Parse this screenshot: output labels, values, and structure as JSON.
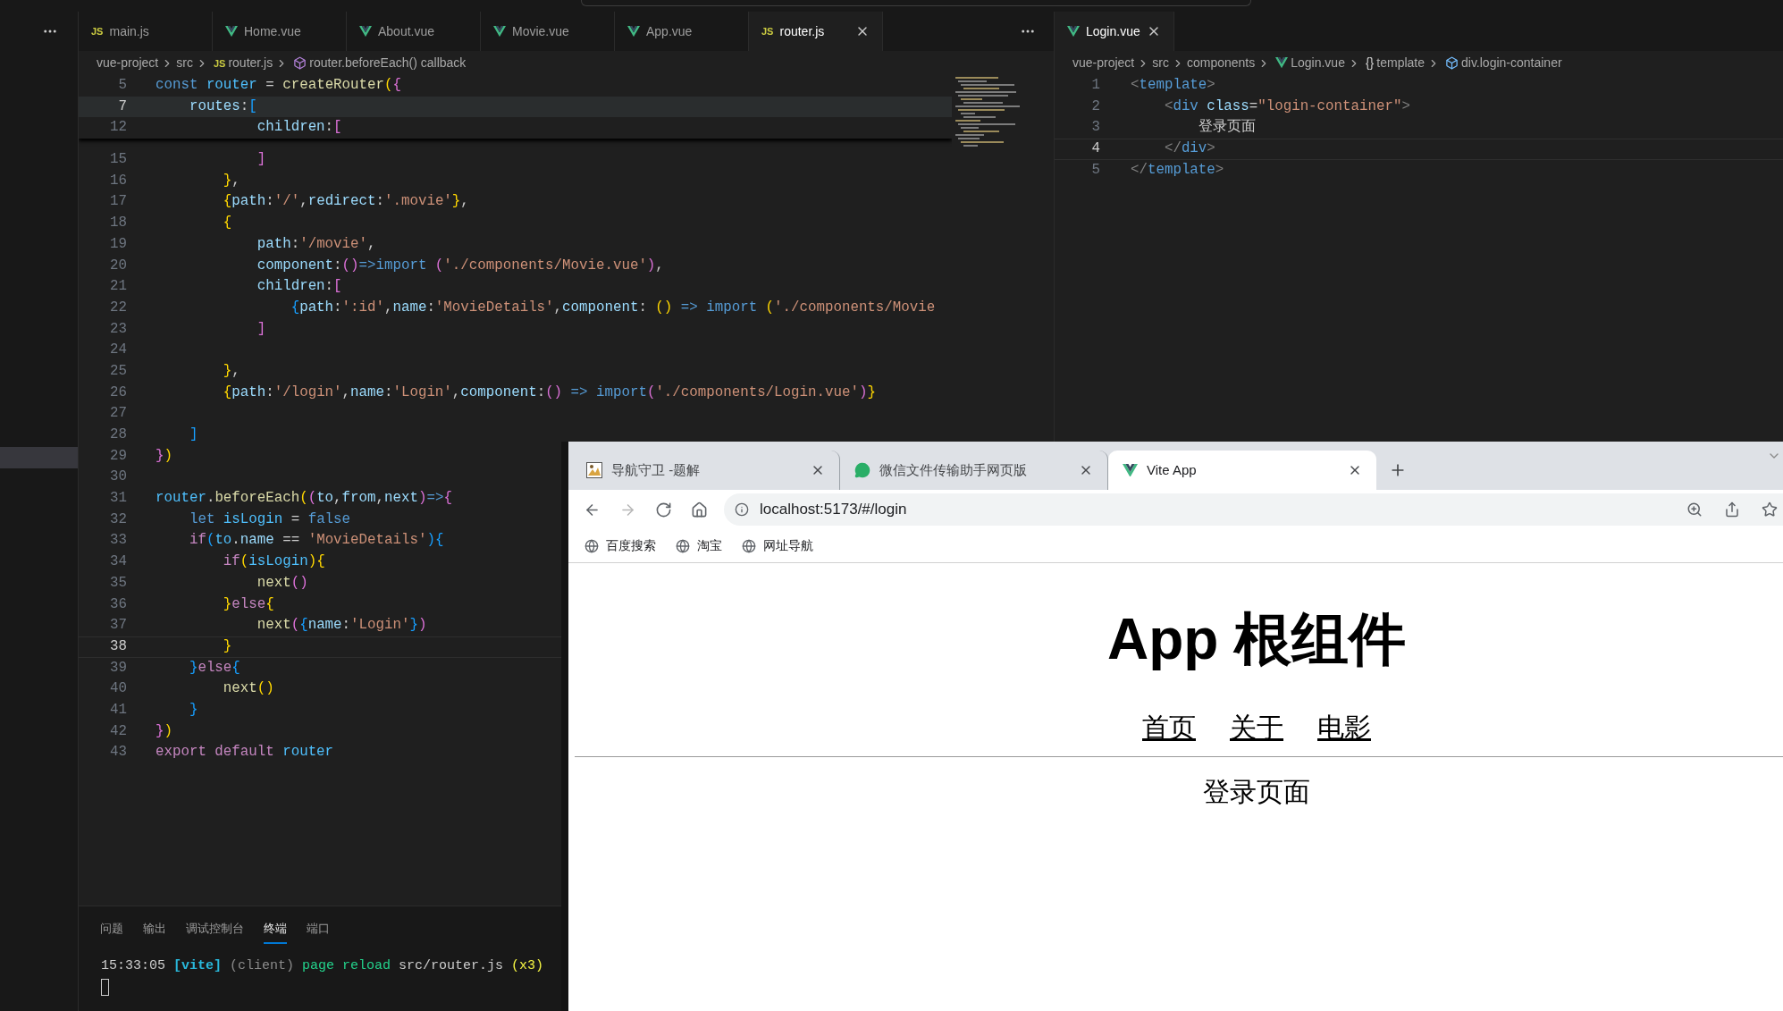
{
  "left_editor": {
    "tabs": [
      {
        "label": "main.js",
        "kind": "js",
        "badge": "JS",
        "selected": false
      },
      {
        "label": "Home.vue",
        "kind": "vue",
        "selected": false
      },
      {
        "label": "About.vue",
        "kind": "vue",
        "selected": false
      },
      {
        "label": "Movie.vue",
        "kind": "vue",
        "selected": false
      },
      {
        "label": "App.vue",
        "kind": "vue",
        "selected": false
      },
      {
        "label": "router.js",
        "kind": "js",
        "badge": "JS",
        "selected": true
      }
    ],
    "breadcrumb": [
      {
        "text": "vue-project",
        "kind": "folder"
      },
      {
        "text": "src",
        "kind": "folder"
      },
      {
        "text": "router.js",
        "kind": "js",
        "badge": "JS"
      },
      {
        "text": "router.beforeEach() callback",
        "kind": "symbol"
      }
    ],
    "sticky_lines": [
      {
        "number": "5",
        "current": false,
        "tokens": [
          {
            "kind": "kw",
            "text": "const "
          },
          {
            "kind": "var",
            "text": "router"
          },
          {
            "kind": "p",
            "text": " = "
          },
          {
            "kind": "fn",
            "text": "createRouter"
          },
          {
            "kind": "b1",
            "text": "("
          },
          {
            "kind": "b2",
            "text": "{"
          }
        ]
      },
      {
        "number": "7",
        "current": true,
        "tokens": [
          {
            "kind": "prop",
            "text": "    routes"
          },
          {
            "kind": "p",
            "text": ":"
          },
          {
            "kind": "b3",
            "text": "["
          }
        ]
      },
      {
        "number": "12",
        "current": false,
        "tokens": [
          {
            "kind": "prop",
            "text": "            children"
          },
          {
            "kind": "p",
            "text": ":"
          },
          {
            "kind": "b2",
            "text": "["
          }
        ]
      }
    ],
    "lines": [
      {
        "number": "15",
        "current": false,
        "tokens": [
          {
            "kind": "b2",
            "text": "            ]"
          }
        ]
      },
      {
        "number": "16",
        "current": false,
        "tokens": [
          {
            "kind": "b1",
            "text": "        }"
          },
          {
            "kind": "p",
            "text": ","
          }
        ]
      },
      {
        "number": "17",
        "current": false,
        "tokens": [
          {
            "kind": "b1",
            "text": "        {"
          },
          {
            "kind": "prop",
            "text": "path"
          },
          {
            "kind": "p",
            "text": ":"
          },
          {
            "kind": "str",
            "text": "'/'"
          },
          {
            "kind": "p",
            "text": ","
          },
          {
            "kind": "prop",
            "text": "redirect"
          },
          {
            "kind": "p",
            "text": ":"
          },
          {
            "kind": "str",
            "text": "'.movie'"
          },
          {
            "kind": "b1",
            "text": "}"
          },
          {
            "kind": "p",
            "text": ","
          }
        ]
      },
      {
        "number": "18",
        "current": false,
        "tokens": [
          {
            "kind": "b1",
            "text": "        {"
          }
        ]
      },
      {
        "number": "19",
        "current": false,
        "tokens": [
          {
            "kind": "prop",
            "text": "            path"
          },
          {
            "kind": "p",
            "text": ":"
          },
          {
            "kind": "str",
            "text": "'/movie'"
          },
          {
            "kind": "p",
            "text": ","
          }
        ]
      },
      {
        "number": "20",
        "current": false,
        "tokens": [
          {
            "kind": "prop",
            "text": "            component"
          },
          {
            "kind": "p",
            "text": ":"
          },
          {
            "kind": "b2",
            "text": "()"
          },
          {
            "kind": "kw",
            "text": "=>import "
          },
          {
            "kind": "b2",
            "text": "("
          },
          {
            "kind": "str",
            "text": "'./components/Movie.vue'"
          },
          {
            "kind": "b2",
            "text": ")"
          },
          {
            "kind": "p",
            "text": ","
          }
        ]
      },
      {
        "number": "21",
        "current": false,
        "tokens": [
          {
            "kind": "prop",
            "text": "            children"
          },
          {
            "kind": "p",
            "text": ":"
          },
          {
            "kind": "b2",
            "text": "["
          }
        ]
      },
      {
        "number": "22",
        "current": false,
        "tokens": [
          {
            "kind": "b3",
            "text": "                {"
          },
          {
            "kind": "prop",
            "text": "path"
          },
          {
            "kind": "p",
            "text": ":"
          },
          {
            "kind": "str",
            "text": "':id'"
          },
          {
            "kind": "p",
            "text": ","
          },
          {
            "kind": "prop",
            "text": "name"
          },
          {
            "kind": "p",
            "text": ":"
          },
          {
            "kind": "str",
            "text": "'MovieDetails'"
          },
          {
            "kind": "p",
            "text": ","
          },
          {
            "kind": "prop",
            "text": "component"
          },
          {
            "kind": "p",
            "text": ": "
          },
          {
            "kind": "b1",
            "text": "()"
          },
          {
            "kind": "kw",
            "text": " => import "
          },
          {
            "kind": "b1",
            "text": "("
          },
          {
            "kind": "str",
            "text": "'./components/Movie"
          }
        ]
      },
      {
        "number": "23",
        "current": false,
        "tokens": [
          {
            "kind": "b2",
            "text": "            ]"
          }
        ]
      },
      {
        "number": "24",
        "current": false
      },
      {
        "number": "25",
        "current": false,
        "tokens": [
          {
            "kind": "b1",
            "text": "        }"
          },
          {
            "kind": "p",
            "text": ","
          }
        ]
      },
      {
        "number": "26",
        "current": false,
        "tokens": [
          {
            "kind": "b1",
            "text": "        {"
          },
          {
            "kind": "prop",
            "text": "path"
          },
          {
            "kind": "p",
            "text": ":"
          },
          {
            "kind": "str",
            "text": "'/login'"
          },
          {
            "kind": "p",
            "text": ","
          },
          {
            "kind": "prop",
            "text": "name"
          },
          {
            "kind": "p",
            "text": ":"
          },
          {
            "kind": "str",
            "text": "'Login'"
          },
          {
            "kind": "p",
            "text": ","
          },
          {
            "kind": "prop",
            "text": "component"
          },
          {
            "kind": "p",
            "text": ":"
          },
          {
            "kind": "b2",
            "text": "()"
          },
          {
            "kind": "kw",
            "text": " => import"
          },
          {
            "kind": "b2",
            "text": "("
          },
          {
            "kind": "str",
            "text": "'./components/Login.vue'"
          },
          {
            "kind": "b2",
            "text": ")"
          },
          {
            "kind": "b1",
            "text": "}"
          }
        ]
      },
      {
        "number": "27",
        "current": false
      },
      {
        "number": "28",
        "current": false,
        "tokens": [
          {
            "kind": "b3",
            "text": "    ]"
          }
        ]
      },
      {
        "number": "29",
        "current": false,
        "tokens": [
          {
            "kind": "b2",
            "text": "}"
          },
          {
            "kind": "b1",
            "text": ")"
          }
        ]
      },
      {
        "number": "30",
        "current": false
      },
      {
        "number": "31",
        "current": false,
        "tokens": [
          {
            "kind": "var",
            "text": "router"
          },
          {
            "kind": "p",
            "text": "."
          },
          {
            "kind": "fn",
            "text": "beforeEach"
          },
          {
            "kind": "b1",
            "text": "("
          },
          {
            "kind": "b2",
            "text": "("
          },
          {
            "kind": "prop",
            "text": "to"
          },
          {
            "kind": "p",
            "text": ","
          },
          {
            "kind": "prop",
            "text": "from"
          },
          {
            "kind": "p",
            "text": ","
          },
          {
            "kind": "prop",
            "text": "next"
          },
          {
            "kind": "b2",
            "text": ")"
          },
          {
            "kind": "kw",
            "text": "=>"
          },
          {
            "kind": "b2",
            "text": "{"
          }
        ]
      },
      {
        "number": "32",
        "current": false,
        "tokens": [
          {
            "kind": "kw",
            "text": "    let "
          },
          {
            "kind": "var",
            "text": "isLogin"
          },
          {
            "kind": "p",
            "text": " = "
          },
          {
            "kind": "kw",
            "text": "false"
          }
        ]
      },
      {
        "number": "33",
        "current": false,
        "tokens": [
          {
            "kind": "ctl",
            "text": "    if"
          },
          {
            "kind": "b3",
            "text": "("
          },
          {
            "kind": "var",
            "text": "to"
          },
          {
            "kind": "p",
            "text": "."
          },
          {
            "kind": "prop",
            "text": "name"
          },
          {
            "kind": "p",
            "text": " == "
          },
          {
            "kind": "str",
            "text": "'MovieDetails'"
          },
          {
            "kind": "b3",
            "text": ")"
          },
          {
            "kind": "b3",
            "text": "{"
          }
        ]
      },
      {
        "number": "34",
        "current": false,
        "tokens": [
          {
            "kind": "ctl",
            "text": "        if"
          },
          {
            "kind": "b1",
            "text": "("
          },
          {
            "kind": "var",
            "text": "isLogin"
          },
          {
            "kind": "b1",
            "text": ")"
          },
          {
            "kind": "b1",
            "text": "{"
          }
        ]
      },
      {
        "number": "35",
        "current": false,
        "tokens": [
          {
            "kind": "fn",
            "text": "            next"
          },
          {
            "kind": "b2",
            "text": "()"
          }
        ]
      },
      {
        "number": "36",
        "current": false,
        "tokens": [
          {
            "kind": "b1",
            "text": "        }"
          },
          {
            "kind": "ctl",
            "text": "else"
          },
          {
            "kind": "b1",
            "text": "{"
          }
        ]
      },
      {
        "number": "37",
        "current": false,
        "tokens": [
          {
            "kind": "fn",
            "text": "            next"
          },
          {
            "kind": "b2",
            "text": "("
          },
          {
            "kind": "b3",
            "text": "{"
          },
          {
            "kind": "prop",
            "text": "name"
          },
          {
            "kind": "p",
            "text": ":"
          },
          {
            "kind": "str",
            "text": "'Login'"
          },
          {
            "kind": "b3",
            "text": "}"
          },
          {
            "kind": "b2",
            "text": ")"
          }
        ]
      },
      {
        "number": "38",
        "current": true,
        "tokens": [
          {
            "kind": "b1",
            "text": "        }"
          }
        ]
      },
      {
        "number": "39",
        "current": false,
        "tokens": [
          {
            "kind": "b3",
            "text": "    }"
          },
          {
            "kind": "ctl",
            "text": "else"
          },
          {
            "kind": "b3",
            "text": "{"
          }
        ]
      },
      {
        "number": "40",
        "current": false,
        "tokens": [
          {
            "kind": "fn",
            "text": "        next"
          },
          {
            "kind": "b1",
            "text": "()"
          }
        ]
      },
      {
        "number": "41",
        "current": false,
        "tokens": [
          {
            "kind": "b3",
            "text": "    }"
          }
        ]
      },
      {
        "number": "42",
        "current": false,
        "tokens": [
          {
            "kind": "b2",
            "text": "}"
          },
          {
            "kind": "b1",
            "text": ")"
          }
        ]
      },
      {
        "number": "43",
        "current": false,
        "tokens": [
          {
            "kind": "ctl",
            "text": "export default "
          },
          {
            "kind": "var",
            "text": "router"
          }
        ]
      }
    ]
  },
  "right_editor": {
    "tabs": [
      {
        "label": "Login.vue",
        "kind": "vue",
        "selected": true
      }
    ],
    "breadcrumb": [
      {
        "text": "vue-project",
        "kind": "folder"
      },
      {
        "text": "src",
        "kind": "folder"
      },
      {
        "text": "components",
        "kind": "folder"
      },
      {
        "text": "Login.vue",
        "kind": "vue"
      },
      {
        "text": "template",
        "kind": "braces",
        "badge": "{}"
      },
      {
        "text": "div.login-container",
        "kind": "symbol"
      }
    ],
    "lines": [
      {
        "number": "1",
        "current": false,
        "tokens": [
          {
            "kind": "punc",
            "text": "<"
          },
          {
            "kind": "kw",
            "text": "template"
          },
          {
            "kind": "punc",
            "text": ">"
          }
        ]
      },
      {
        "number": "2",
        "current": false,
        "tokens": [
          {
            "kind": "punc",
            "text": "    <"
          },
          {
            "kind": "kw",
            "text": "div"
          },
          {
            "kind": "prop",
            "text": " class"
          },
          {
            "kind": "p",
            "text": "="
          },
          {
            "kind": "str",
            "text": "\"login-container\""
          },
          {
            "kind": "punc",
            "text": ">"
          }
        ]
      },
      {
        "number": "3",
        "current": false,
        "tokens": [
          {
            "kind": "p",
            "text": "        登录页面"
          }
        ]
      },
      {
        "number": "4",
        "current": true,
        "tokens": [
          {
            "kind": "punc",
            "text": "    </"
          },
          {
            "kind": "kw",
            "text": "div"
          },
          {
            "kind": "punc",
            "text": ">"
          }
        ]
      },
      {
        "number": "5",
        "current": false,
        "tokens": [
          {
            "kind": "punc",
            "text": "</"
          },
          {
            "kind": "kw",
            "text": "template"
          },
          {
            "kind": "punc",
            "text": ">"
          }
        ]
      }
    ]
  },
  "panel": {
    "tabs": [
      {
        "label": "问题",
        "selected": false
      },
      {
        "label": "输出",
        "selected": false
      },
      {
        "label": "调试控制台",
        "selected": false
      },
      {
        "label": "终端",
        "selected": true
      },
      {
        "label": "端口",
        "selected": false
      }
    ],
    "terminal": [
      {
        "kind": "p",
        "text": "15:33:05 "
      },
      {
        "kind": "vite",
        "text": "[vite]"
      },
      {
        "kind": "dim",
        "text": " (client)"
      },
      {
        "kind": "green",
        "text": " page reload"
      },
      {
        "kind": "p",
        "text": " src/router.js "
      },
      {
        "kind": "yellow",
        "text": "(x3)"
      }
    ]
  },
  "browser": {
    "tabs": [
      {
        "title": "导航守卫 -题解",
        "kind": "picture",
        "selected": false
      },
      {
        "title": "微信文件传输助手网页版",
        "kind": "chat",
        "selected": false
      },
      {
        "title": "Vite App",
        "kind": "vue",
        "selected": true
      }
    ],
    "nav_buttons": [
      {
        "kind": "back",
        "disabled": false
      },
      {
        "kind": "forward",
        "disabled": true
      },
      {
        "kind": "reload",
        "disabled": false
      },
      {
        "kind": "home",
        "disabled": false
      }
    ],
    "address": "localhost:5173/#/login",
    "bookmarks": [
      "百度搜索",
      "淘宝",
      "网址导航"
    ],
    "page": {
      "heading": "App 根组件",
      "links": [
        "首页",
        "关于",
        "电影"
      ],
      "content": "登录页面"
    }
  }
}
